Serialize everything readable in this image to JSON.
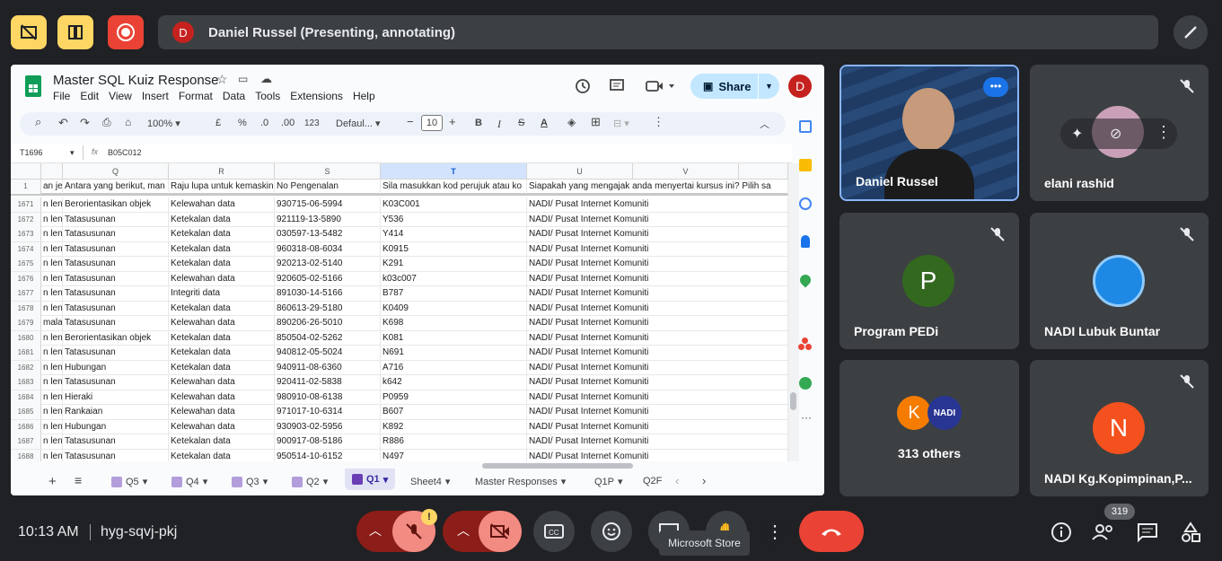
{
  "presenter": {
    "initial": "D",
    "label": "Daniel Russel (Presenting, annotating)"
  },
  "sheet": {
    "title": "Master SQL Kuiz Response",
    "menu": [
      "File",
      "Edit",
      "View",
      "Insert",
      "Format",
      "Data",
      "Tools",
      "Extensions",
      "Help"
    ],
    "share_label": "Share",
    "avatar_initial": "D",
    "zoom": "100%",
    "currency": "£",
    "percent": "%",
    "dec_less": ".0",
    "dec_more": ".00",
    "numfmt": "123",
    "font": "Defaul...",
    "font_size": "10",
    "cell_ref": "T1696",
    "formula": "B05C012",
    "columns": [
      "Q",
      "R",
      "S",
      "T",
      "U",
      "V"
    ],
    "header_row": {
      "num": "1",
      "p": "an jen",
      "q": "Antara yang berikut, man",
      "r": "Raju lupa untuk kemaskini",
      "s": "No Pengenalan",
      "t": "Sila masukkan kod perujuk atau ko",
      "u": "Siapakah yang mengajak anda menyertai kursus ini? Pilih sa"
    },
    "rows": [
      {
        "num": "1671",
        "p": "n leng",
        "q": "Berorientasikan objek",
        "r": "Kelewahan data",
        "s": "930715-06-5994",
        "t": "K03C001",
        "u": "NADI/ Pusat Internet Komuniti"
      },
      {
        "num": "1672",
        "p": "n leng",
        "q": "Tatasusunan",
        "r": "Ketekalan data",
        "s": "921119-13-5890",
        "t": "Y536",
        "u": "NADI/ Pusat Internet Komuniti"
      },
      {
        "num": "1673",
        "p": "n leng",
        "q": "Tatasusunan",
        "r": "Ketekalan data",
        "s": "030597-13-5482",
        "t": "Y414",
        "u": "NADI/ Pusat Internet Komuniti"
      },
      {
        "num": "1674",
        "p": "n leng",
        "q": "Tatasusunan",
        "r": "Ketekalan data",
        "s": "960318-08-6034",
        "t": "K0915",
        "u": "NADI/ Pusat Internet Komuniti"
      },
      {
        "num": "1675",
        "p": "n leng",
        "q": "Tatasusunan",
        "r": "Ketekalan data",
        "s": "920213-02-5140",
        "t": "K291",
        "u": "NADI/ Pusat Internet Komuniti"
      },
      {
        "num": "1676",
        "p": "n leng",
        "q": "Tatasusunan",
        "r": "Kelewahan data",
        "s": "920605-02-5166",
        "t": "k03c007",
        "u": "NADI/ Pusat Internet Komuniti"
      },
      {
        "num": "1677",
        "p": "n leng",
        "q": "Tatasusunan",
        "r": "Integriti data",
        "s": "891030-14-5166",
        "t": "B787",
        "u": "NADI/ Pusat Internet Komuniti"
      },
      {
        "num": "1678",
        "p": "n leng",
        "q": "Tatasusunan",
        "r": "Ketekalan data",
        "s": "860613-29-5180",
        "t": "K0409",
        "u": "NADI/ Pusat Internet Komuniti"
      },
      {
        "num": "1679",
        "p": "malan",
        "q": "Tatasusunan",
        "r": "Kelewahan data",
        "s": "890206-26-5010",
        "t": "K698",
        "u": "NADI/ Pusat Internet Komuniti"
      },
      {
        "num": "1680",
        "p": "n leng",
        "q": "Berorientasikan objek",
        "r": "Ketekalan data",
        "s": "850504-02-5262",
        "t": "K081",
        "u": "NADI/ Pusat Internet Komuniti"
      },
      {
        "num": "1681",
        "p": "n leng",
        "q": "Tatasusunan",
        "r": "Ketekalan data",
        "s": "940812-05-5024",
        "t": "N691",
        "u": "NADI/ Pusat Internet Komuniti"
      },
      {
        "num": "1682",
        "p": "n leng",
        "q": "Hubungan",
        "r": "Ketekalan data",
        "s": "940911-08-6360",
        "t": "A716",
        "u": "NADI/ Pusat Internet Komuniti"
      },
      {
        "num": "1683",
        "p": "n leng",
        "q": "Tatasusunan",
        "r": "Kelewahan data",
        "s": "920411-02-5838",
        "t": "k642",
        "u": "NADI/ Pusat Internet Komuniti"
      },
      {
        "num": "1684",
        "p": "n leng",
        "q": "Hieraki",
        "r": "Kelewahan data",
        "s": "980910-08-6138",
        "t": "P0959",
        "u": "NADI/ Pusat Internet Komuniti"
      },
      {
        "num": "1685",
        "p": "n leng",
        "q": "Rankaian",
        "r": "Kelewahan data",
        "s": "971017-10-6314",
        "t": "B607",
        "u": "NADI/ Pusat Internet Komuniti"
      },
      {
        "num": "1686",
        "p": "n leng",
        "q": "Hubungan",
        "r": "Kelewahan data",
        "s": "930903-02-5956",
        "t": "K892",
        "u": "NADI/ Pusat Internet Komuniti"
      },
      {
        "num": "1687",
        "p": "n leng",
        "q": "Tatasusunan",
        "r": "Ketekalan data",
        "s": "900917-08-5186",
        "t": "R886",
        "u": "NADI/ Pusat Internet Komuniti"
      },
      {
        "num": "1688",
        "p": "n leng",
        "q": "Tatasusunan",
        "r": "Ketekalan data",
        "s": "950514-10-6152",
        "t": "N497",
        "u": "NADI/ Pusat Internet Komuniti"
      }
    ],
    "tabs": [
      "Q5",
      "Q4",
      "Q3",
      "Q2",
      "Q1",
      "Sheet4",
      "Master Responses",
      "Q1P",
      "Q2F"
    ]
  },
  "participants": {
    "self": {
      "name": "Daniel Russel"
    },
    "p2": {
      "name": "elani rashid"
    },
    "p3": {
      "name": "Program PEDi",
      "initial": "P"
    },
    "p4": {
      "name": "NADI Lubuk Buntar"
    },
    "p5": {
      "name": "313 others",
      "initial": "K",
      "badge": "NADI"
    },
    "p6": {
      "name": "NADI Kg.Kopimpinan,P...",
      "initial": "N"
    }
  },
  "bottom": {
    "time": "10:13 AM",
    "meeting_code": "hyg-sqvj-pkj",
    "people_count": "319",
    "tooltip": "Microsoft Store"
  }
}
